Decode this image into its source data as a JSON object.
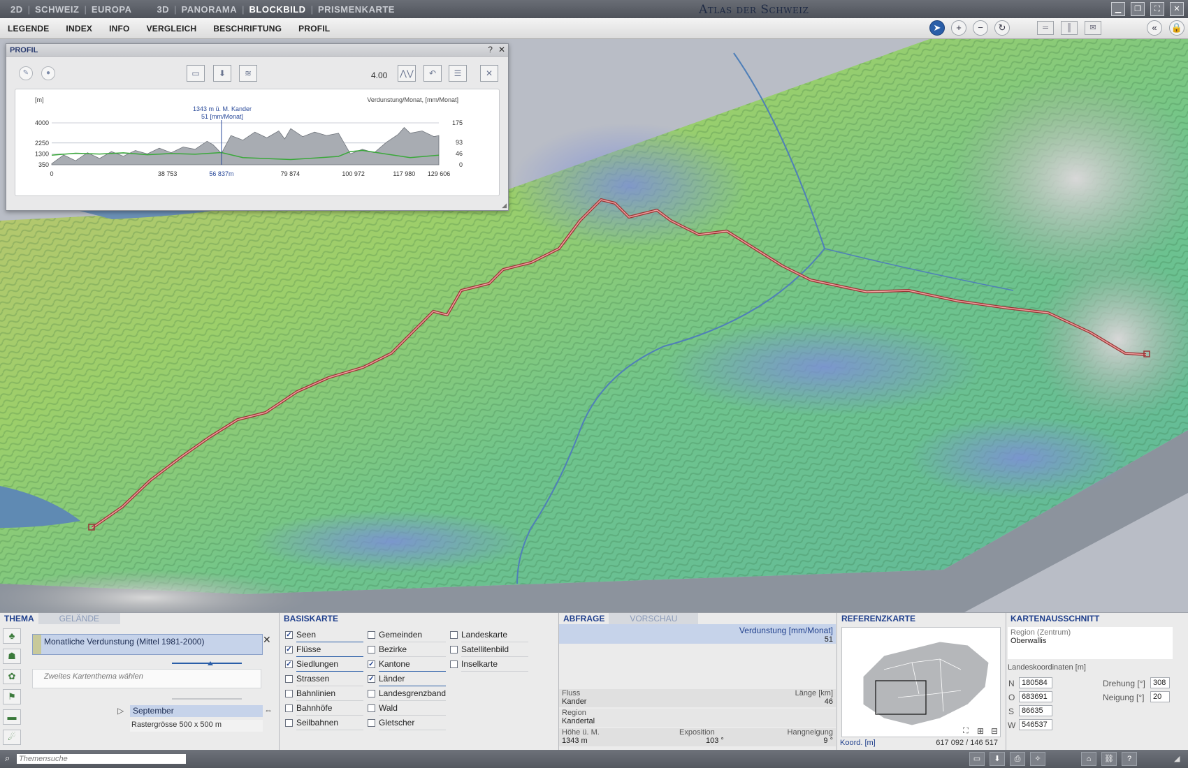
{
  "view_tabs": [
    {
      "label": "2D",
      "active": false
    },
    {
      "label": "SCHWEIZ",
      "active": false
    },
    {
      "label": "EUROPA",
      "active": false
    },
    {
      "label": "3D",
      "active": false
    },
    {
      "label": "PANORAMA",
      "active": false
    },
    {
      "label": "BLOCKBILD",
      "active": true
    },
    {
      "label": "PRISMENKARTE",
      "active": false
    }
  ],
  "app_title": "Atlas der Schweiz",
  "menu": [
    "LEGENDE",
    "INDEX",
    "INFO",
    "VERGLEICH",
    "BESCHRIFTUNG",
    "PROFIL"
  ],
  "profil": {
    "title": "PROFIL",
    "help": "?",
    "close": "✕",
    "exaggeration": "4.00",
    "chart_unit_left": "[m]",
    "chart_unit_right": "Verdunstung/Monat,  [mm/Monat]",
    "cursor_label_1": "1343 m ü. M.  Kander",
    "cursor_label_2": "51 [mm/Monat]",
    "y_left_ticks": [
      "4000",
      "2250",
      "1300",
      "350"
    ],
    "y_right_ticks": [
      "175",
      "93",
      "46",
      "0"
    ],
    "x_ticks": [
      "0",
      "38 753",
      "56 837m",
      "79 874",
      "100 972",
      "117 980",
      "129 606"
    ]
  },
  "chart_data": {
    "type": "area",
    "xlabel": "",
    "ylabel": "[m]",
    "y2label": "Verdunstung/Monat,  [mm/Monat]",
    "xlim": [
      0,
      129606
    ],
    "ylim": [
      350,
      4000
    ],
    "y2lim": [
      0,
      175
    ],
    "cursor": {
      "x": 56837,
      "elevation": 1343,
      "value": 51,
      "river": "Kander"
    },
    "series": [
      {
        "name": "",
        "x": [
          0,
          4000,
          8000,
          12000,
          16000,
          20000,
          24000,
          28000,
          32000,
          36000,
          40000,
          44000,
          48000,
          52000,
          54000,
          56837,
          60000,
          64000,
          68000,
          72000,
          76000,
          78000,
          80000,
          84000,
          88000,
          92000,
          96000,
          100000,
          104000,
          108000,
          112000,
          116000,
          118000,
          120000,
          124000,
          128000,
          129606
        ],
        "values": [
          450,
          1200,
          700,
          1400,
          900,
          1500,
          1100,
          1600,
          1300,
          1800,
          1400,
          1900,
          1700,
          2400,
          2100,
          1343,
          2900,
          2500,
          3200,
          2700,
          3300,
          2600,
          3500,
          2800,
          3200,
          2900,
          3100,
          1300,
          1700,
          1400,
          2300,
          3000,
          3600,
          3100,
          3300,
          2800,
          2900
        ]
      },
      {
        "name": "",
        "x": [
          0,
          8000,
          16000,
          24000,
          32000,
          40000,
          48000,
          56837,
          64000,
          72000,
          80000,
          88000,
          96000,
          100000,
          104000,
          112000,
          120000,
          129606
        ],
        "values": [
          40,
          48,
          45,
          50,
          42,
          47,
          44,
          51,
          30,
          26,
          22,
          28,
          35,
          55,
          60,
          45,
          30,
          40
        ]
      }
    ]
  },
  "thema": {
    "tab_active": "THEMA",
    "tab_inactive": "GELÄNDE",
    "theme1": "Monatliche Verdunstung (Mittel 1981-2000)",
    "theme2_placeholder": "Zweites Kartenthema wählen",
    "month": "September",
    "raster": "Rastergrösse 500 x 500 m",
    "remove": "✕"
  },
  "basiskarte": {
    "title": "BASISKARTE",
    "col1": [
      {
        "label": "Seen",
        "checked": true
      },
      {
        "label": "Flüsse",
        "checked": true
      },
      {
        "label": "Siedlungen",
        "checked": true
      },
      {
        "label": "Strassen",
        "checked": false
      },
      {
        "label": "Bahnlinien",
        "checked": false
      },
      {
        "label": "Bahnhöfe",
        "checked": false
      },
      {
        "label": "Seilbahnen",
        "checked": false
      }
    ],
    "col2": [
      {
        "label": "Gemeinden",
        "checked": false
      },
      {
        "label": "Bezirke",
        "checked": false
      },
      {
        "label": "Kantone",
        "checked": true
      },
      {
        "label": "Länder",
        "checked": true
      },
      {
        "label": "Landesgrenzband",
        "checked": false
      },
      {
        "label": "Wald",
        "checked": false
      },
      {
        "label": "Gletscher",
        "checked": false
      }
    ],
    "col3": [
      {
        "label": "Landeskarte",
        "checked": false
      },
      {
        "label": "Satellitenbild",
        "checked": false
      },
      {
        "label": "Inselkarte",
        "checked": false
      }
    ]
  },
  "abfrage": {
    "tab_active": "ABFRAGE",
    "tab_inactive": "VORSCHAU",
    "head_label": "Verdunstung [mm/Monat]",
    "head_value": "51",
    "fluss_label": "Fluss",
    "laenge_label": "Länge [km]",
    "fluss_value": "Kander",
    "laenge_value": "46",
    "region_label": "Region",
    "region_value": "Kandertal",
    "hoehe_label": "Höhe ü. M.",
    "exposition_label": "Exposition",
    "hang_label": "Hangneigung",
    "hoehe_value": "1343 m",
    "exposition_value": "103 °",
    "hang_value": "9 °"
  },
  "referenzkarte": {
    "title": "REFERENZKARTE",
    "koord_label": "Koord. [m]",
    "koord_value": "617 092 / 146 517"
  },
  "kartenausschnitt": {
    "title": "KARTENAUSSCHNITT",
    "region_label": "Region (Zentrum)",
    "region_value": "Oberwallis",
    "coords_label": "Landeskoordinaten [m]",
    "n_label": "N",
    "n_value": "180584",
    "o_label": "O",
    "o_value": "683691",
    "s_label": "S",
    "s_value": "86635",
    "w_label": "W",
    "w_value": "546537",
    "drehung_label": "Drehung [°]",
    "drehung_value": "308",
    "neigung_label": "Neigung [°]",
    "neigung_value": "20"
  },
  "status": {
    "search_placeholder": "Themensuche"
  }
}
